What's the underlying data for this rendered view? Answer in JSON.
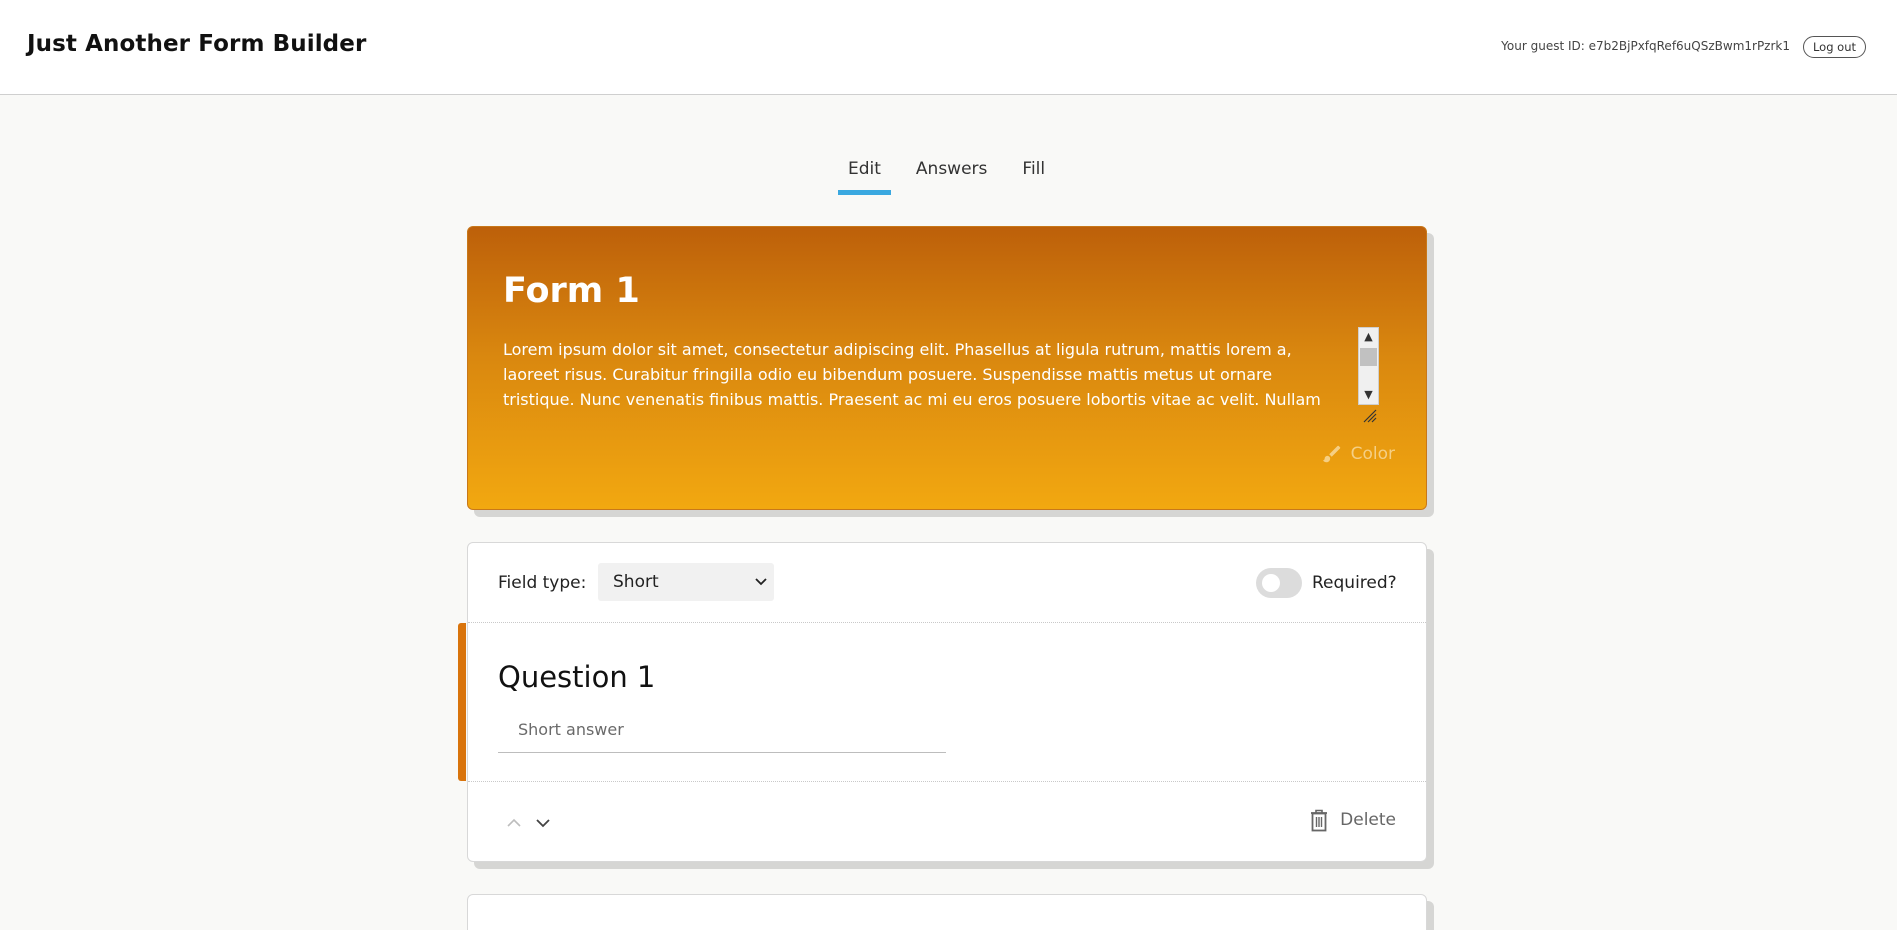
{
  "header": {
    "title": "Just Another Form Builder",
    "guest_id": "Your guest ID: e7b2BjPxfqRef6uQSzBwm1rPzrk1",
    "logout_label": "Log out"
  },
  "tabs": [
    {
      "label": "Edit",
      "active": true
    },
    {
      "label": "Answers",
      "active": false
    },
    {
      "label": "Fill",
      "active": false
    }
  ],
  "form": {
    "title": "Form 1",
    "description": " Lorem ipsum dolor sit amet, consectetur adipiscing elit. Phasellus at ligula rutrum, mattis lorem a, laoreet risus. Curabitur fringilla odio eu bibendum posuere. Suspendisse mattis metus ut ornare tristique. Nunc venenatis finibus mattis. Praesent ac mi eu eros posuere lobortis vitae ac velit. Nullam sit amet quam et ante tincidunt bibendum nec nec felis. Nunc suscipit sem scelerisque risus suscipit",
    "color_label": "Color",
    "header_gradient": [
      "#bd600a",
      "#f2a810"
    ]
  },
  "question": {
    "field_type_label": "Field type:",
    "field_type_value": "Short",
    "required_label": "Required?",
    "required": false,
    "title": "Question 1",
    "answer_placeholder": "Short answer",
    "delete_label": "Delete",
    "accent_color": "#d9740c"
  },
  "colors": {
    "tab_indicator": "#3aa8e0",
    "background": "#f9f9f7"
  }
}
